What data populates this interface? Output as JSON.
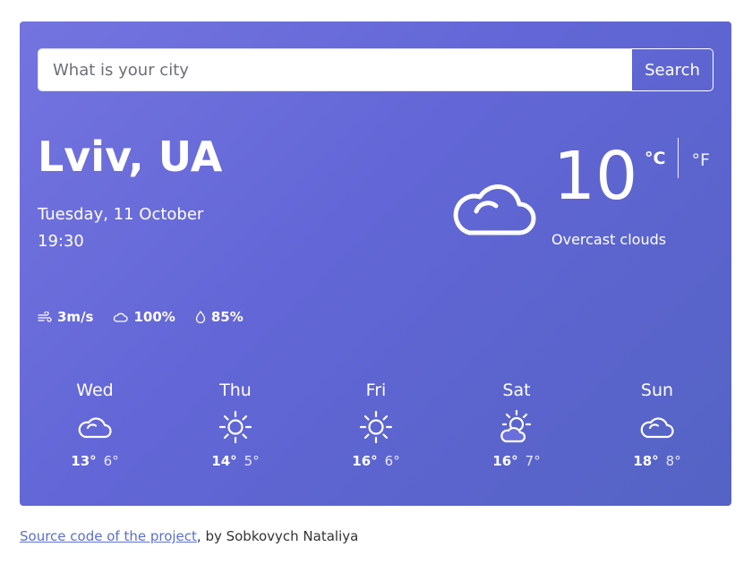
{
  "search": {
    "placeholder": "What is your city",
    "button_label": "Search"
  },
  "current": {
    "city": "Lviv, UA",
    "date": "Tuesday, 11 October",
    "time": "19:30",
    "temperature": "10",
    "unit_celsius": "°C",
    "unit_fahrenheit": "°F",
    "description": "Overcast clouds",
    "icon": "cloud-icon"
  },
  "stats": {
    "wind": "3m/s",
    "clouds": "100%",
    "humidity": "85%"
  },
  "forecast": [
    {
      "day": "Wed",
      "max": "13°",
      "min": "6°",
      "icon": "cloud-icon"
    },
    {
      "day": "Thu",
      "max": "14°",
      "min": "5°",
      "icon": "sun-icon"
    },
    {
      "day": "Fri",
      "max": "16°",
      "min": "6°",
      "icon": "sun-icon"
    },
    {
      "day": "Sat",
      "max": "16°",
      "min": "7°",
      "icon": "partly-cloudy-icon"
    },
    {
      "day": "Sun",
      "max": "18°",
      "min": "8°",
      "icon": "cloud-icon"
    }
  ],
  "footer": {
    "link_text": "Source code of the project",
    "author_text": ", by Sobkovych Nataliya"
  },
  "colors": {
    "card_gradient_start": "#7474e0",
    "card_gradient_end": "#5463c4",
    "link": "#5a6fd1"
  }
}
